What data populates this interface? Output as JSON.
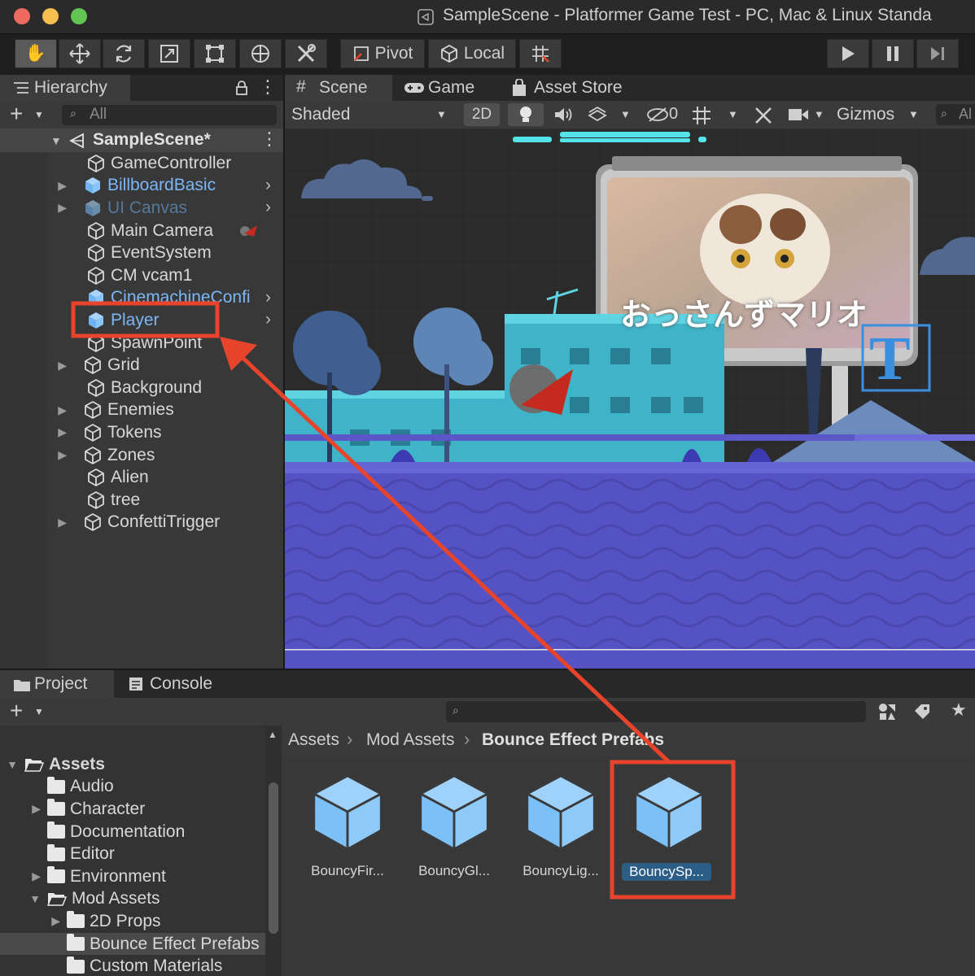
{
  "window": {
    "title": "SampleScene - Platformer Game Test - PC, Mac & Linux Standa"
  },
  "toolbar": {
    "pivot_label": "Pivot",
    "local_label": "Local"
  },
  "hierarchy": {
    "tab_label": "Hierarchy",
    "search_placeholder": "All",
    "scene_name": "SampleScene*",
    "items": [
      {
        "label": "GameController"
      },
      {
        "label": "BillboardBasic"
      },
      {
        "label": "UI Canvas"
      },
      {
        "label": "Main Camera"
      },
      {
        "label": "EventSystem"
      },
      {
        "label": "CM vcam1"
      },
      {
        "label": "CinemachineConfi"
      },
      {
        "label": "Player"
      },
      {
        "label": "SpawnPoint"
      },
      {
        "label": "Grid"
      },
      {
        "label": "Background"
      },
      {
        "label": "Enemies"
      },
      {
        "label": "Tokens"
      },
      {
        "label": "Zones"
      },
      {
        "label": "Alien"
      },
      {
        "label": "tree"
      },
      {
        "label": "ConfettiTrigger"
      }
    ]
  },
  "scene_view": {
    "tabs": [
      {
        "label": "Scene"
      },
      {
        "label": "Game"
      },
      {
        "label": "Asset Store"
      }
    ],
    "shading_mode": "Shaded",
    "mode_2d": "2D",
    "hidden_count": "0",
    "gizmos_label": "Gizmos",
    "search_placeholder": "Al",
    "billboard_text": "おっさんずマリオ",
    "text_icon_glyph": "T"
  },
  "project": {
    "tabs": [
      {
        "label": "Project"
      },
      {
        "label": "Console"
      }
    ],
    "breadcrumb": {
      "root": "Assets",
      "mid": "Mod Assets",
      "current": "Bounce Effect Prefabs"
    },
    "folders": [
      {
        "label": "Assets"
      },
      {
        "label": "Audio"
      },
      {
        "label": "Character"
      },
      {
        "label": "Documentation"
      },
      {
        "label": "Editor"
      },
      {
        "label": "Environment"
      },
      {
        "label": "Mod Assets"
      },
      {
        "label": "2D Props"
      },
      {
        "label": "Bounce Effect Prefabs"
      },
      {
        "label": "Custom Materials"
      }
    ],
    "assets": [
      {
        "label": "BouncyFir..."
      },
      {
        "label": "BouncyGl..."
      },
      {
        "label": "BouncyLig..."
      },
      {
        "label": "BouncySp..."
      }
    ]
  },
  "colors": {
    "annotation": "#e8442c",
    "prefab_text": "#7cb6f5",
    "selection": "#2c5d87"
  }
}
